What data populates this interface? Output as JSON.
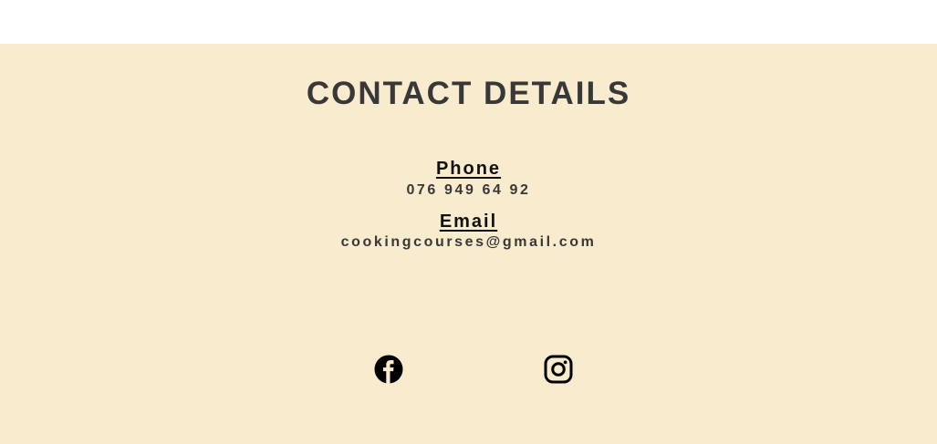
{
  "section": {
    "title": "CONTACT DETAILS",
    "background_color": "#f9ebcd"
  },
  "phone": {
    "label": "Phone",
    "value": "076 949 64 92"
  },
  "email": {
    "label": "Email",
    "value": "cookingcourses@gmail.com"
  },
  "social": {
    "icons": [
      "facebook-icon",
      "instagram-icon"
    ]
  }
}
